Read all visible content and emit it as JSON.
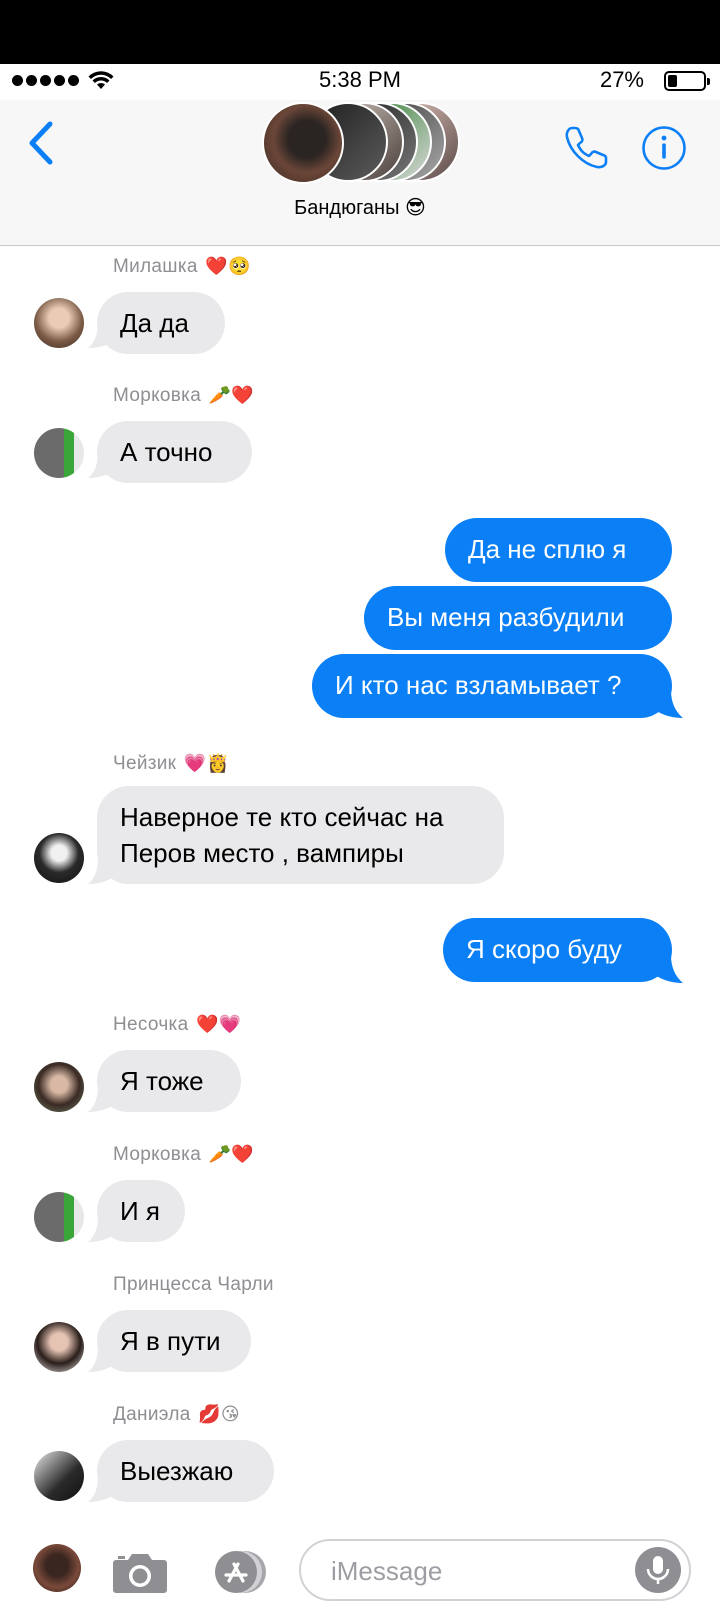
{
  "status_bar": {
    "time": "5:38 PM",
    "battery": "27%",
    "battery_level": 0.27
  },
  "header": {
    "group_name": "Бандюганы 😎"
  },
  "messages": [
    {
      "sender": "Милашка",
      "sender_emoji": "❤️🥺",
      "text": "Да да"
    },
    {
      "sender": "Морковка",
      "sender_emoji": "🥕❤️",
      "text": "А точно"
    },
    {
      "text": "Да не сплю я"
    },
    {
      "text": "Вы меня разбудили"
    },
    {
      "text": "И кто нас взламывает ?"
    },
    {
      "sender": "Чейзик",
      "sender_emoji": "💗👸",
      "text_line1": "Наверное те кто сейчас на",
      "text_line2": "Перов место , вампиры"
    },
    {
      "text": "Я скоро буду"
    },
    {
      "sender": "Несочка",
      "sender_emoji": "❤️💗",
      "text": "Я тоже"
    },
    {
      "sender": "Морковка",
      "sender_emoji": "🥕❤️",
      "text": "И я"
    },
    {
      "sender": "Принцесса Чарли",
      "sender_emoji": "",
      "text": "Я в пути"
    },
    {
      "sender": "Даниэла",
      "sender_emoji": "💋😘",
      "text": "Выезжаю"
    }
  ],
  "input": {
    "placeholder": "iMessage"
  },
  "colors": {
    "accent": "#0b7ff5",
    "incoming": "#e9e9eb",
    "header_bg": "#f7f7f8"
  },
  "icons": [
    "back-chevron-icon",
    "phone-icon",
    "info-icon",
    "camera-icon",
    "app-store-icon",
    "microphone-icon",
    "wifi-icon"
  ]
}
